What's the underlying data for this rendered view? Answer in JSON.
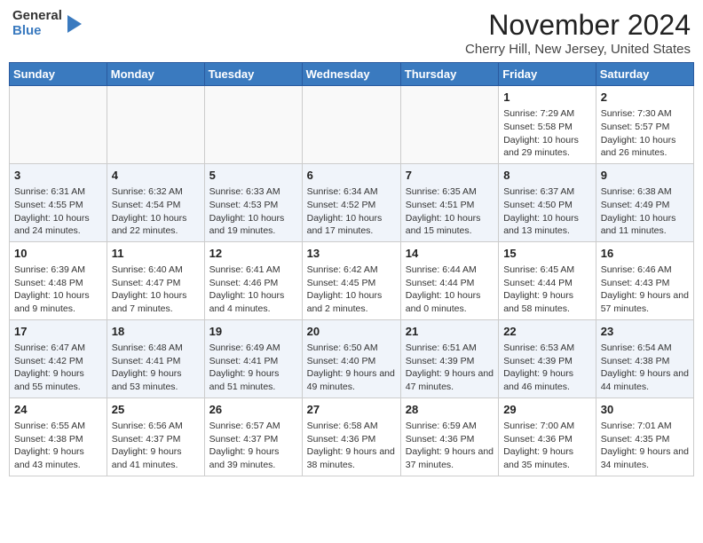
{
  "header": {
    "logo": {
      "general": "General",
      "blue": "Blue"
    },
    "title": "November 2024",
    "subtitle": "Cherry Hill, New Jersey, United States"
  },
  "weekdays": [
    "Sunday",
    "Monday",
    "Tuesday",
    "Wednesday",
    "Thursday",
    "Friday",
    "Saturday"
  ],
  "weeks": [
    [
      {
        "day": "",
        "info": ""
      },
      {
        "day": "",
        "info": ""
      },
      {
        "day": "",
        "info": ""
      },
      {
        "day": "",
        "info": ""
      },
      {
        "day": "",
        "info": ""
      },
      {
        "day": "1",
        "info": "Sunrise: 7:29 AM\nSunset: 5:58 PM\nDaylight: 10 hours and 29 minutes."
      },
      {
        "day": "2",
        "info": "Sunrise: 7:30 AM\nSunset: 5:57 PM\nDaylight: 10 hours and 26 minutes."
      }
    ],
    [
      {
        "day": "3",
        "info": "Sunrise: 6:31 AM\nSunset: 4:55 PM\nDaylight: 10 hours and 24 minutes."
      },
      {
        "day": "4",
        "info": "Sunrise: 6:32 AM\nSunset: 4:54 PM\nDaylight: 10 hours and 22 minutes."
      },
      {
        "day": "5",
        "info": "Sunrise: 6:33 AM\nSunset: 4:53 PM\nDaylight: 10 hours and 19 minutes."
      },
      {
        "day": "6",
        "info": "Sunrise: 6:34 AM\nSunset: 4:52 PM\nDaylight: 10 hours and 17 minutes."
      },
      {
        "day": "7",
        "info": "Sunrise: 6:35 AM\nSunset: 4:51 PM\nDaylight: 10 hours and 15 minutes."
      },
      {
        "day": "8",
        "info": "Sunrise: 6:37 AM\nSunset: 4:50 PM\nDaylight: 10 hours and 13 minutes."
      },
      {
        "day": "9",
        "info": "Sunrise: 6:38 AM\nSunset: 4:49 PM\nDaylight: 10 hours and 11 minutes."
      }
    ],
    [
      {
        "day": "10",
        "info": "Sunrise: 6:39 AM\nSunset: 4:48 PM\nDaylight: 10 hours and 9 minutes."
      },
      {
        "day": "11",
        "info": "Sunrise: 6:40 AM\nSunset: 4:47 PM\nDaylight: 10 hours and 7 minutes."
      },
      {
        "day": "12",
        "info": "Sunrise: 6:41 AM\nSunset: 4:46 PM\nDaylight: 10 hours and 4 minutes."
      },
      {
        "day": "13",
        "info": "Sunrise: 6:42 AM\nSunset: 4:45 PM\nDaylight: 10 hours and 2 minutes."
      },
      {
        "day": "14",
        "info": "Sunrise: 6:44 AM\nSunset: 4:44 PM\nDaylight: 10 hours and 0 minutes."
      },
      {
        "day": "15",
        "info": "Sunrise: 6:45 AM\nSunset: 4:44 PM\nDaylight: 9 hours and 58 minutes."
      },
      {
        "day": "16",
        "info": "Sunrise: 6:46 AM\nSunset: 4:43 PM\nDaylight: 9 hours and 57 minutes."
      }
    ],
    [
      {
        "day": "17",
        "info": "Sunrise: 6:47 AM\nSunset: 4:42 PM\nDaylight: 9 hours and 55 minutes."
      },
      {
        "day": "18",
        "info": "Sunrise: 6:48 AM\nSunset: 4:41 PM\nDaylight: 9 hours and 53 minutes."
      },
      {
        "day": "19",
        "info": "Sunrise: 6:49 AM\nSunset: 4:41 PM\nDaylight: 9 hours and 51 minutes."
      },
      {
        "day": "20",
        "info": "Sunrise: 6:50 AM\nSunset: 4:40 PM\nDaylight: 9 hours and 49 minutes."
      },
      {
        "day": "21",
        "info": "Sunrise: 6:51 AM\nSunset: 4:39 PM\nDaylight: 9 hours and 47 minutes."
      },
      {
        "day": "22",
        "info": "Sunrise: 6:53 AM\nSunset: 4:39 PM\nDaylight: 9 hours and 46 minutes."
      },
      {
        "day": "23",
        "info": "Sunrise: 6:54 AM\nSunset: 4:38 PM\nDaylight: 9 hours and 44 minutes."
      }
    ],
    [
      {
        "day": "24",
        "info": "Sunrise: 6:55 AM\nSunset: 4:38 PM\nDaylight: 9 hours and 43 minutes."
      },
      {
        "day": "25",
        "info": "Sunrise: 6:56 AM\nSunset: 4:37 PM\nDaylight: 9 hours and 41 minutes."
      },
      {
        "day": "26",
        "info": "Sunrise: 6:57 AM\nSunset: 4:37 PM\nDaylight: 9 hours and 39 minutes."
      },
      {
        "day": "27",
        "info": "Sunrise: 6:58 AM\nSunset: 4:36 PM\nDaylight: 9 hours and 38 minutes."
      },
      {
        "day": "28",
        "info": "Sunrise: 6:59 AM\nSunset: 4:36 PM\nDaylight: 9 hours and 37 minutes."
      },
      {
        "day": "29",
        "info": "Sunrise: 7:00 AM\nSunset: 4:36 PM\nDaylight: 9 hours and 35 minutes."
      },
      {
        "day": "30",
        "info": "Sunrise: 7:01 AM\nSunset: 4:35 PM\nDaylight: 9 hours and 34 minutes."
      }
    ]
  ]
}
